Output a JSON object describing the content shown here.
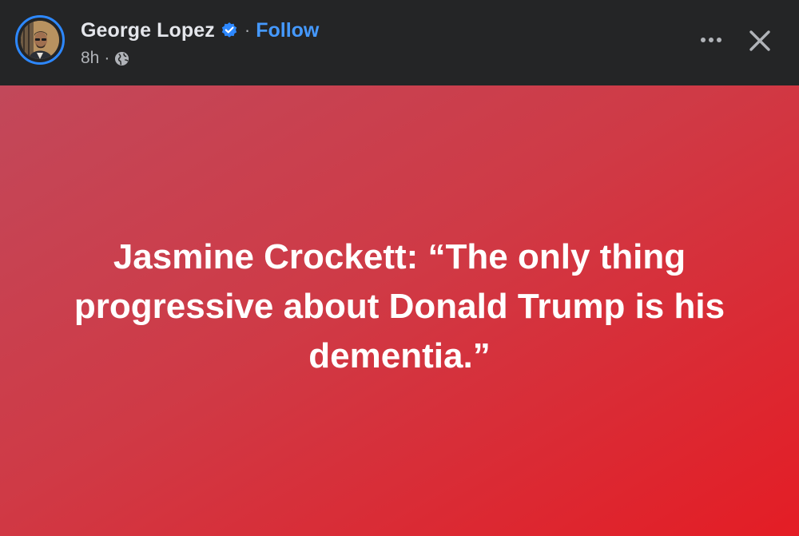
{
  "header": {
    "author_name": "George Lopez",
    "verified_icon": "verified-badge-icon",
    "separator": "·",
    "follow_label": "Follow",
    "timestamp": "8h",
    "meta_separator": "·",
    "audience_icon": "globe-icon",
    "more_icon": "more-options-icon",
    "close_icon": "close-icon"
  },
  "post": {
    "text": "Jasmine Crockett: “The only thing progressive about Donald Trump is his dementia.”"
  },
  "colors": {
    "header_bg": "#242526",
    "accent": "#4599ff",
    "verified": "#2d88ff",
    "post_bg_start": "#c2485a",
    "post_bg_end": "#e41d25"
  }
}
